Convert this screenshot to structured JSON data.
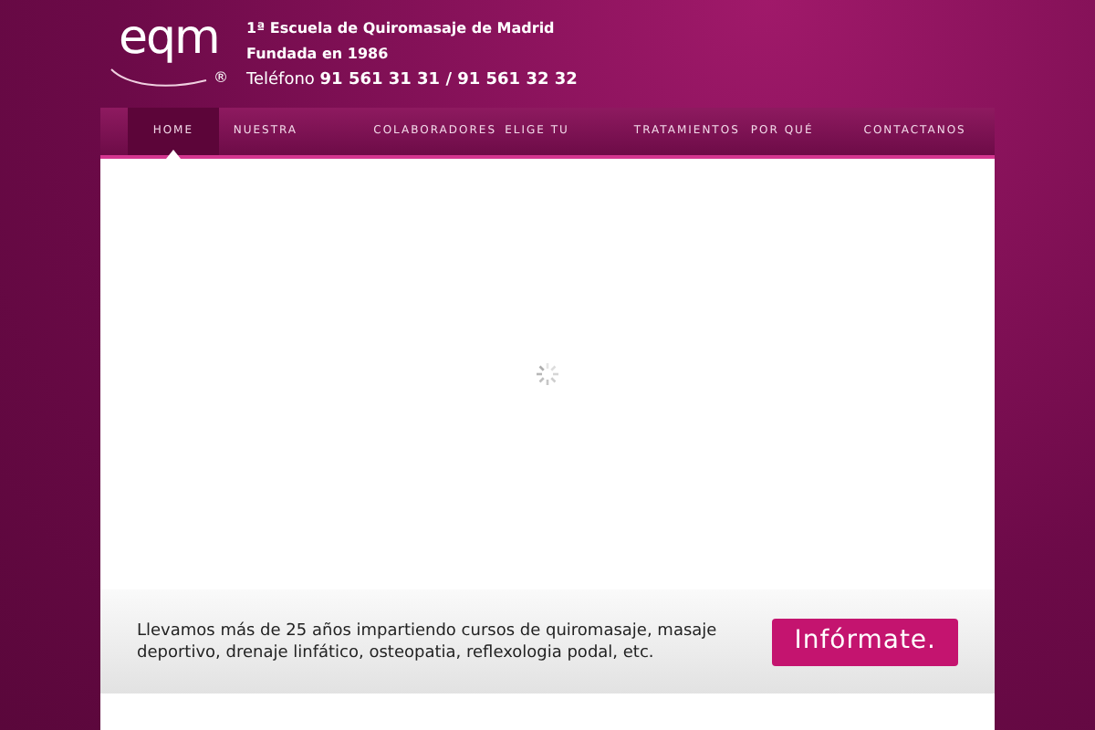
{
  "header": {
    "logo": {
      "text": "eqm",
      "mark": "®"
    },
    "lines": [
      "1ª Escuela de Quiromasaje de Madrid",
      "Fundada en 1986",
      "Teléfono **91 561 31 31 / 91 561 32 32**"
    ]
  },
  "nav": [
    {
      "label": "HOME",
      "selected": true
    },
    {
      "label": "NUESTRA",
      "selected": false
    },
    {
      "label": "COLABORADORES",
      "selected": false
    },
    {
      "label": "ELIGE TU",
      "selected": false
    },
    {
      "label": "TRATAMIENTOS",
      "selected": false
    },
    {
      "label": "POR QUÉ",
      "selected": false
    },
    {
      "label": "CONTACTANOS",
      "selected": false
    }
  ],
  "promo": {
    "text": "Llevamos más de 25 años impartiendo cursos de quiromasaje, masaje deportivo, drenaje linfático, osteopatia, reflexologia podal, etc.",
    "button": "Infórmate."
  }
}
